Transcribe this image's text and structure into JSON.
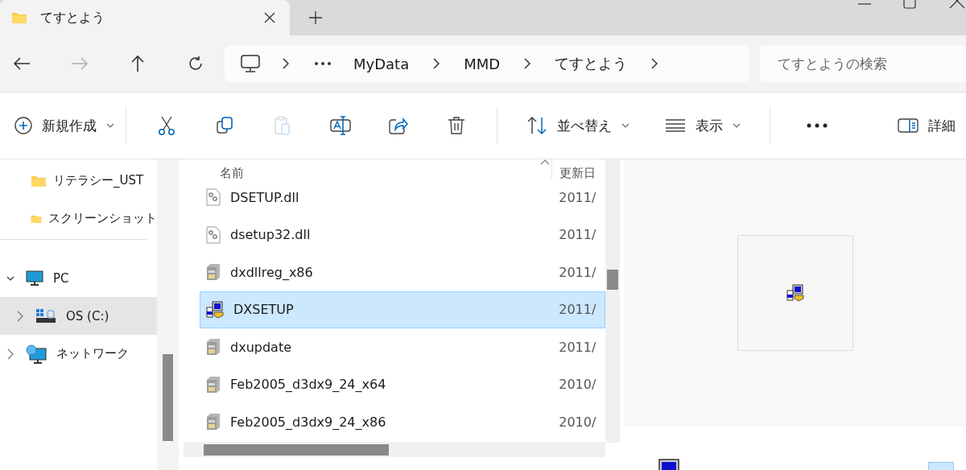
{
  "tabs": [
    {
      "label": "てすとよう",
      "selected": true
    }
  ],
  "nav_buttons": [
    {
      "kind": "back",
      "disabled": false
    },
    {
      "kind": "forward",
      "disabled": true
    },
    {
      "kind": "up",
      "disabled": false
    },
    {
      "kind": "refresh",
      "disabled": false
    }
  ],
  "breadcrumb": [
    "MyData",
    "MMD",
    "てすとよう"
  ],
  "search": {
    "placeholder": "てすとようの検索"
  },
  "toolbar": [
    {
      "kind": "new",
      "label": "新規作成",
      "disabled": false
    },
    {
      "kind": "cut",
      "disabled": false
    },
    {
      "kind": "copy",
      "disabled": false
    },
    {
      "kind": "paste",
      "disabled": true
    },
    {
      "kind": "rename",
      "disabled": false
    },
    {
      "kind": "share",
      "disabled": false
    },
    {
      "kind": "delete",
      "disabled": false
    },
    {
      "kind": "sort",
      "label": "並べ替え",
      "disabled": false
    },
    {
      "kind": "view",
      "label": "表示",
      "disabled": false
    },
    {
      "kind": "more",
      "disabled": false
    },
    {
      "kind": "details",
      "label": "詳細",
      "disabled": false
    }
  ],
  "sidebar": {
    "items": [
      {
        "kind": "folder",
        "label": "リテラシー_UST",
        "selected": false
      },
      {
        "kind": "folder",
        "label": "スクリーンショット",
        "selected": false
      },
      {
        "kind": "pc",
        "label": "PC",
        "selected": false,
        "expanded": true,
        "children": [
          {
            "kind": "drive",
            "label": "OS (C:)",
            "selected": true,
            "expanded": false
          }
        ]
      },
      {
        "kind": "network",
        "label": "ネットワーク",
        "selected": false,
        "expanded": false
      }
    ]
  },
  "table": {
    "columns": [
      "名前",
      "更新日"
    ],
    "rows": [
      {
        "kind": "dll",
        "name": "DSETUP.dll",
        "modified": "2011/",
        "selected": false
      },
      {
        "kind": "dll",
        "name": "dsetup32.dll",
        "modified": "2011/",
        "selected": false
      },
      {
        "kind": "app",
        "name": "dxdllreg_x86",
        "modified": "2011/",
        "selected": false
      },
      {
        "kind": "setup",
        "name": "DXSETUP",
        "modified": "2011/",
        "selected": true
      },
      {
        "kind": "app",
        "name": "dxupdate",
        "modified": "2011/",
        "selected": false
      },
      {
        "kind": "app",
        "name": "Feb2005_d3dx9_24_x64",
        "modified": "2010/",
        "selected": false
      },
      {
        "kind": "app",
        "name": "Feb2005_d3dx9_24_x86",
        "modified": "2010/",
        "selected": false
      }
    ]
  }
}
